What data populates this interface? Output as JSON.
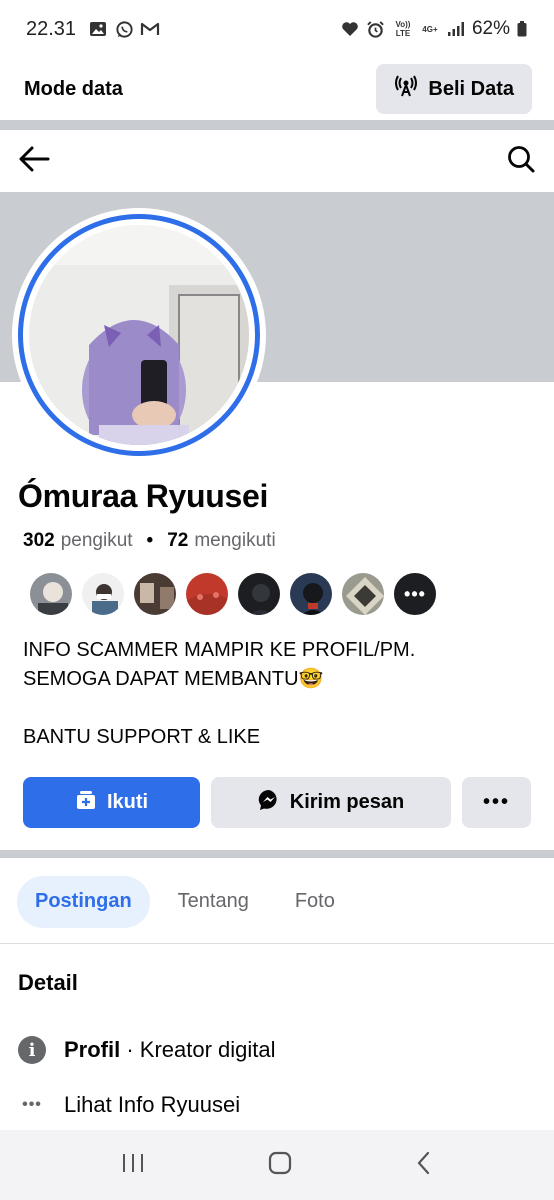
{
  "status_bar": {
    "time": "22.31",
    "network_volte": "Vo)) LTE",
    "network_type": "4G+",
    "battery": "62%"
  },
  "data_bar": {
    "title": "Mode data",
    "buy_label": "Beli Data"
  },
  "profile": {
    "name": "Ómuraa Ryuusei",
    "followers_count": "302",
    "followers_label": "pengikut",
    "following_count": "72",
    "following_label": "mengikuti",
    "more_followers": "•••"
  },
  "bio": {
    "line1": "INFO SCAMMER MAMPIR KE PROFIL/PM.",
    "line2": "SEMOGA DAPAT MEMBANTU🤓",
    "line3": "BANTU SUPPORT & LIKE"
  },
  "actions": {
    "follow": "Ikuti",
    "message": "Kirim pesan",
    "more": "•••"
  },
  "tabs": [
    "Postingan",
    "Tentang",
    "Foto"
  ],
  "details": {
    "title": "Detail",
    "profile_label": "Profil",
    "profile_value": " · Kreator digital",
    "info_link": "Lihat Info Ryuusei"
  },
  "colors": {
    "accent": "#2e6ee8",
    "cover": "#c9ccd1",
    "button_grey": "#e4e6eb"
  }
}
